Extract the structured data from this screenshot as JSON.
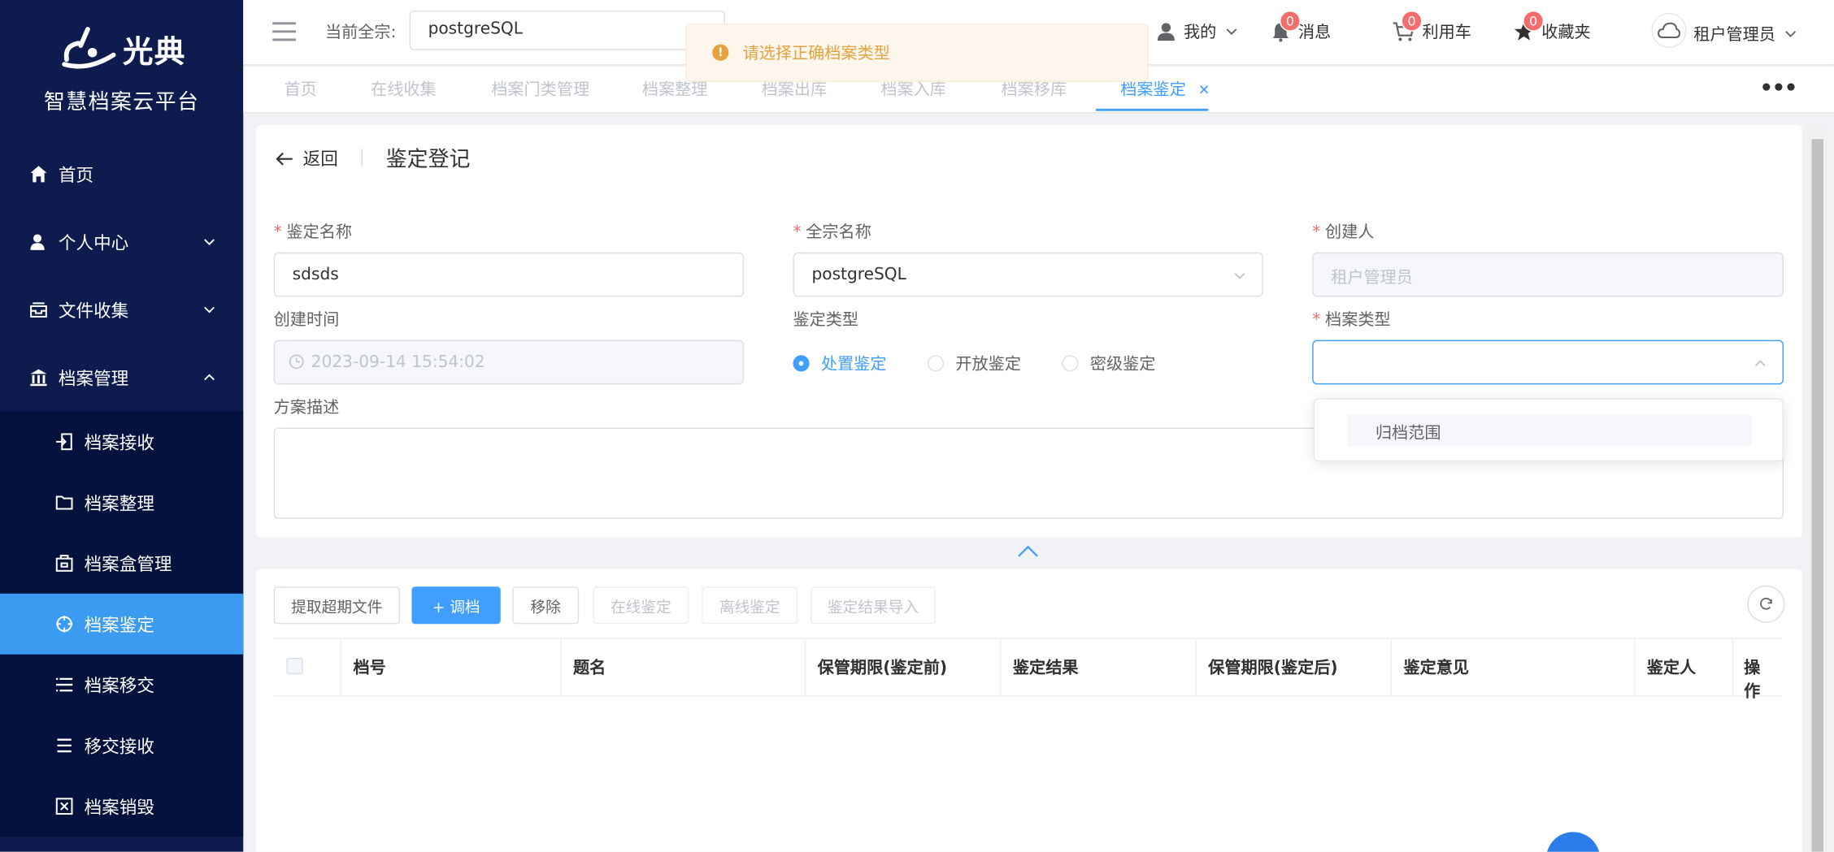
{
  "sidebar": {
    "brand": "光典",
    "subtitle": "智慧档案云平台",
    "items": [
      {
        "label": "首页",
        "icon": "home-icon"
      },
      {
        "label": "个人中心",
        "icon": "user-icon"
      },
      {
        "label": "文件收集",
        "icon": "inbox-icon"
      },
      {
        "label": "档案管理",
        "icon": "bank-icon"
      }
    ],
    "subitems": [
      {
        "label": "档案接收",
        "icon": "receive-icon"
      },
      {
        "label": "档案整理",
        "icon": "folder-icon"
      },
      {
        "label": "档案盒管理",
        "icon": "box-icon"
      },
      {
        "label": "档案鉴定",
        "icon": "target-icon"
      },
      {
        "label": "档案移交",
        "icon": "transfer-icon"
      },
      {
        "label": "移交接收",
        "icon": "list-icon"
      },
      {
        "label": "档案销毁",
        "icon": "destroy-icon"
      }
    ]
  },
  "header": {
    "fond_label": "当前全宗:",
    "fond_value": "postgreSQL",
    "mine": "我的",
    "messages": "消息",
    "messages_count": "0",
    "cart": "利用车",
    "cart_count": "0",
    "favorites": "收藏夹",
    "favorites_count": "0",
    "user": "租户管理员"
  },
  "toast": {
    "text": "请选择正确档案类型"
  },
  "tabs": [
    "首页",
    "在线收集",
    "档案门类管理",
    "档案整理",
    "档案出库",
    "档案入库",
    "档案移库",
    "档案鉴定"
  ],
  "form": {
    "back": "返回",
    "title": "鉴定登记",
    "name_label": "鉴定名称",
    "name_value": "sdsds",
    "fond_label": "全宗名称",
    "fond_value": "postgreSQL",
    "creator_label": "创建人",
    "creator_value": "租户管理员",
    "created_label": "创建时间",
    "created_value": "2023-09-14 15:54:02",
    "type_label": "鉴定类型",
    "types": [
      "处置鉴定",
      "开放鉴定",
      "密级鉴定"
    ],
    "type_selected": "处置鉴定",
    "archive_type_label": "档案类型",
    "archive_type_value": "",
    "archive_type_options": [
      "归档范围"
    ],
    "desc_label": "方案描述"
  },
  "toolbar": {
    "buttons": [
      "提取超期文件",
      "+ 调档",
      "移除",
      "在线鉴定",
      "离线鉴定",
      "鉴定结果导入"
    ]
  },
  "table": {
    "columns": [
      "档号",
      "题名",
      "保管期限(鉴定前)",
      "鉴定结果",
      "保管期限(鉴定后)",
      "鉴定意见",
      "鉴定人",
      "操作"
    ]
  },
  "colors": {
    "primary": "#409eff",
    "sidebar": "#0d1b4e",
    "warning": "#e6a23c"
  }
}
